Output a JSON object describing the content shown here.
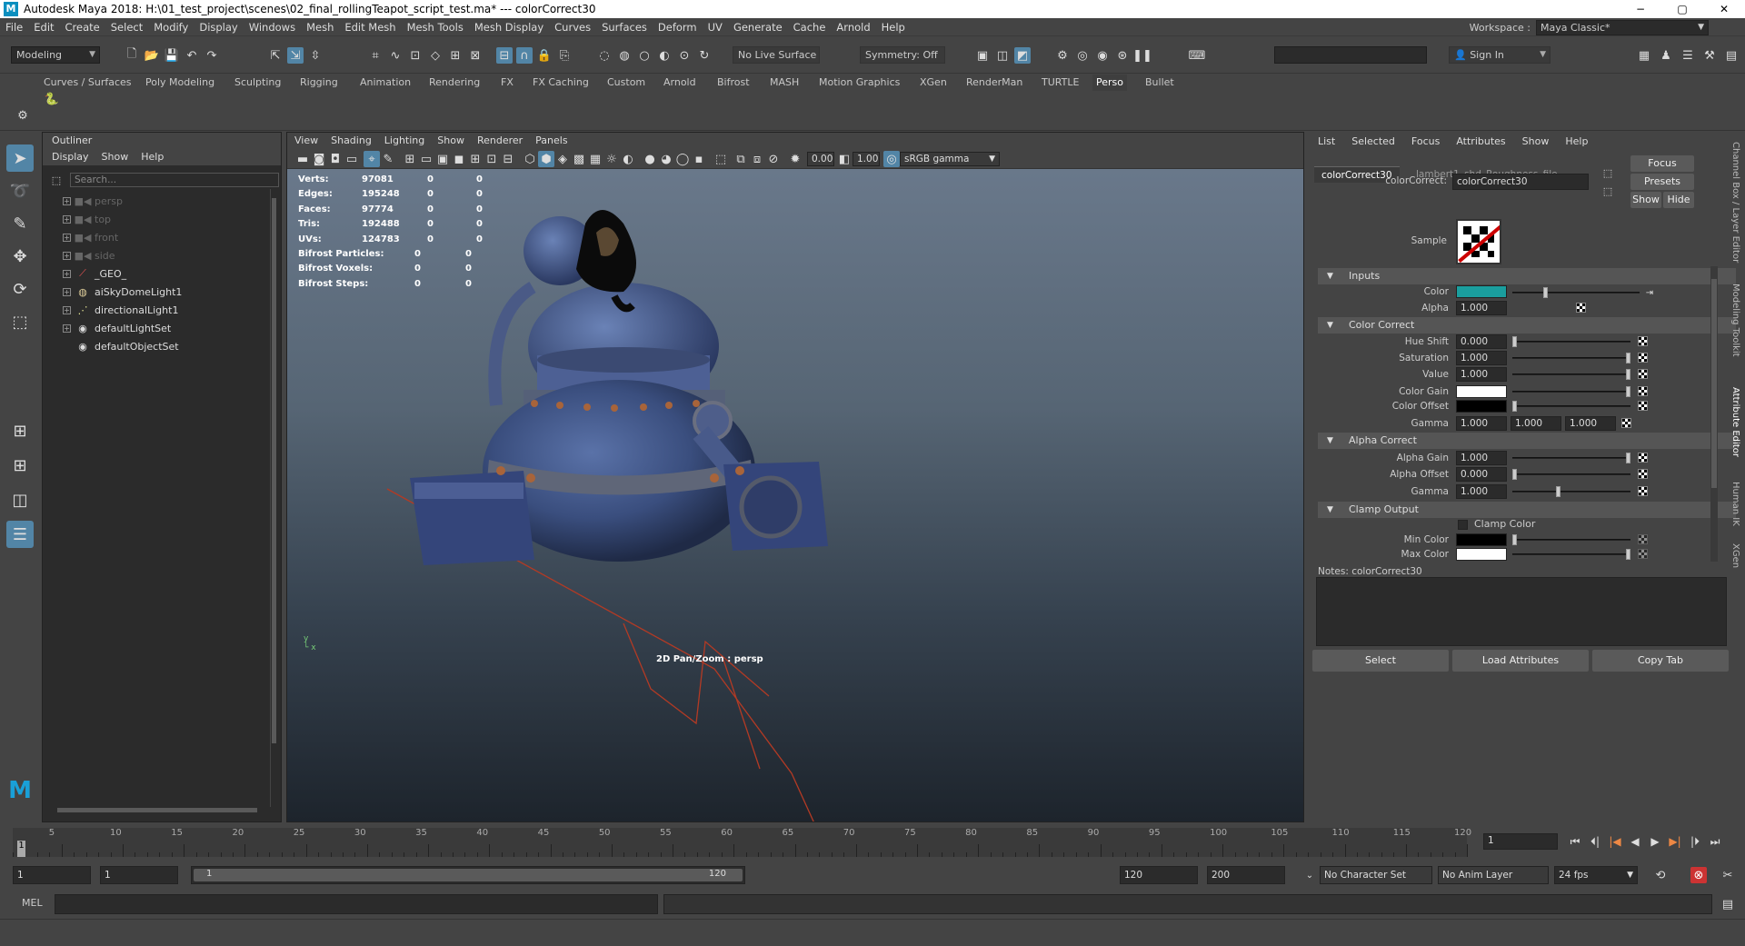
{
  "window": {
    "title": "Autodesk Maya 2018: H:\\01_test_project\\scenes\\02_final_rollingTeapot_script_test.ma*   ---   colorCorrect30",
    "logo": "M",
    "controls": [
      "−",
      "▢",
      "✕"
    ]
  },
  "menu": [
    "File",
    "Edit",
    "Create",
    "Select",
    "Modify",
    "Display",
    "Windows",
    "Mesh",
    "Edit Mesh",
    "Mesh Tools",
    "Mesh Display",
    "Curves",
    "Surfaces",
    "Deform",
    "UV",
    "Generate",
    "Cache",
    "Arnold",
    "Help"
  ],
  "workspace": {
    "label": "Workspace :",
    "value": "Maya Classic*"
  },
  "status": {
    "mode": "Modeling",
    "live_surface": "No Live Surface",
    "symmetry": "Symmetry: Off",
    "sign_in": "Sign In"
  },
  "shelf_tabs": [
    "Curves / Surfaces",
    "Poly Modeling",
    "Sculpting",
    "Rigging",
    "Animation",
    "Rendering",
    "FX",
    "FX Caching",
    "Custom",
    "Arnold",
    "Bifrost",
    "MASH",
    "Motion Graphics",
    "XGen",
    "RenderMan",
    "TURTLE",
    "Perso",
    "Bullet"
  ],
  "shelf_active": "Perso",
  "outliner": {
    "title": "Outliner",
    "menu": [
      "Display",
      "Show",
      "Help"
    ],
    "search_placeholder": "Search...",
    "items": [
      {
        "label": "persp",
        "icon": "camera-icon",
        "dim": true
      },
      {
        "label": "top",
        "icon": "camera-icon",
        "dim": true
      },
      {
        "label": "front",
        "icon": "camera-icon",
        "dim": true
      },
      {
        "label": "side",
        "icon": "camera-icon",
        "dim": true
      },
      {
        "label": "_GEO_",
        "icon": "transform-icon",
        "dim": false
      },
      {
        "label": "aiSkyDomeLight1",
        "icon": "skydome-icon",
        "dim": false
      },
      {
        "label": "directionalLight1",
        "icon": "light-icon",
        "dim": false
      },
      {
        "label": "defaultLightSet",
        "icon": "set-icon",
        "dim": false
      },
      {
        "label": "defaultObjectSet",
        "icon": "set-icon",
        "dim": false
      }
    ]
  },
  "viewport": {
    "menu": [
      "View",
      "Shading",
      "Lighting",
      "Show",
      "Renderer",
      "Panels"
    ],
    "exposure": "0.00",
    "gamma": "1.00",
    "color_space": "sRGB gamma",
    "camera_label": "2D Pan/Zoom : persp",
    "hud": [
      {
        "label": "Verts:",
        "a": "97081",
        "b": "0",
        "c": "0"
      },
      {
        "label": "Edges:",
        "a": "195248",
        "b": "0",
        "c": "0"
      },
      {
        "label": "Faces:",
        "a": "97774",
        "b": "0",
        "c": "0"
      },
      {
        "label": "Tris:",
        "a": "192488",
        "b": "0",
        "c": "0"
      },
      {
        "label": "UVs:",
        "a": "124783",
        "b": "0",
        "c": "0"
      },
      {
        "label": "Bifrost Particles:",
        "a": "0",
        "b": "0",
        "c": ""
      },
      {
        "label": "Bifrost Voxels:",
        "a": "0",
        "b": "0",
        "c": ""
      },
      {
        "label": "Bifrost Steps:",
        "a": "0",
        "b": "0",
        "c": ""
      }
    ]
  },
  "attr": {
    "menu": [
      "List",
      "Selected",
      "Focus",
      "Attributes",
      "Show",
      "Help"
    ],
    "tabs": [
      "colorCorrect30",
      "lambert1_shd_Roughness_file"
    ],
    "node_label": "colorCorrect:",
    "node_name": "colorCorrect30",
    "focus": "Focus",
    "presets": "Presets",
    "show": "Show",
    "hide": "Hide",
    "sample": "Sample",
    "sections": {
      "inputs": "Inputs",
      "color_correct": "Color Correct",
      "alpha_correct": "Alpha Correct",
      "clamp": "Clamp Output"
    },
    "color_label": "Color",
    "color_value": "#1a9e9e",
    "alpha": {
      "label": "Alpha",
      "value": "1.000"
    },
    "hue_shift": {
      "label": "Hue Shift",
      "value": "0.000"
    },
    "saturation": {
      "label": "Saturation",
      "value": "1.000"
    },
    "value": {
      "label": "Value",
      "value": "1.000"
    },
    "color_gain": {
      "label": "Color Gain",
      "color": "#ffffff"
    },
    "color_offset": {
      "label": "Color Offset",
      "color": "#000000"
    },
    "gamma": {
      "label": "Gamma",
      "v1": "1.000",
      "v2": "1.000",
      "v3": "1.000"
    },
    "alpha_gain": {
      "label": "Alpha Gain",
      "value": "1.000"
    },
    "alpha_offset": {
      "label": "Alpha Offset",
      "value": "0.000"
    },
    "alpha_gamma": {
      "label": "Gamma",
      "value": "1.000"
    },
    "clamp_color": "Clamp Color",
    "min_color": {
      "label": "Min Color",
      "color": "#000000"
    },
    "max_color": {
      "label": "Max Color",
      "color": "#ffffff"
    },
    "notes": "Notes:  colorCorrect30",
    "buttons": [
      "Select",
      "Load Attributes",
      "Copy Tab"
    ]
  },
  "side_tabs": [
    "Channel Box / Layer Editor",
    "Modeling Toolkit",
    "Attribute Editor",
    "Human IK",
    "XGen"
  ],
  "timeline": {
    "ticks": [
      "5",
      "10",
      "15",
      "20",
      "25",
      "30",
      "35",
      "40",
      "45",
      "50",
      "55",
      "60",
      "65",
      "70",
      "75",
      "80",
      "85",
      "90",
      "95",
      "100",
      "105",
      "110",
      "115",
      "120"
    ],
    "current": "1",
    "current_field": "1"
  },
  "range": {
    "start": "1",
    "start2": "1",
    "slider_start": "1",
    "slider_end": "120",
    "end": "120",
    "end2": "200",
    "char_set": "No Character Set",
    "anim_layer": "No Anim Layer",
    "fps": "24 fps"
  },
  "cmd": {
    "label": "MEL"
  }
}
